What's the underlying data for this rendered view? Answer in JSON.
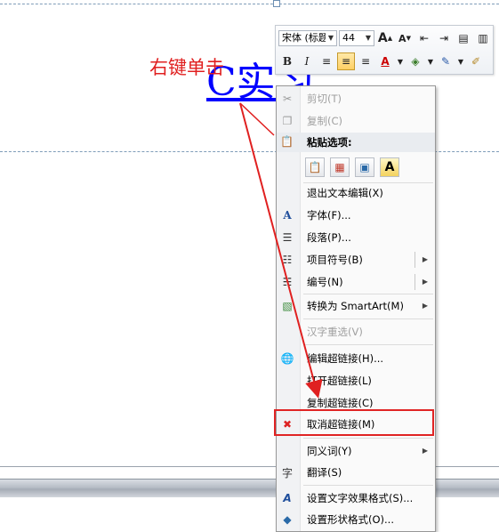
{
  "document": {
    "link_text": "C实习",
    "annotation": "右键单击"
  },
  "mini_toolbar": {
    "font_name": "宋体 (标题",
    "font_size": "44",
    "grow_icon": "A",
    "shrink_icon": "A",
    "bold": "B",
    "italic": "I",
    "font_color": "A"
  },
  "context_menu": {
    "items": [
      {
        "label": "剪切(T)",
        "icon": "scissors-icon",
        "disabled": true
      },
      {
        "label": "复制(C)",
        "icon": "copy-icon",
        "disabled": true
      },
      {
        "label": "粘贴选项:",
        "icon": "paste-icon",
        "header": true
      },
      {
        "label": "退出文本编辑(X)"
      },
      {
        "label": "字体(F)...",
        "icon": "font-icon"
      },
      {
        "label": "段落(P)...",
        "icon": "paragraph-icon"
      },
      {
        "label": "项目符号(B)",
        "icon": "bullets-icon",
        "submenu": true
      },
      {
        "label": "编号(N)",
        "icon": "numbering-icon",
        "submenu": true
      },
      {
        "label": "转换为 SmartArt(M)",
        "icon": "smartart-icon",
        "submenu": true
      },
      {
        "label": "汉字重选(V)",
        "disabled": true
      },
      {
        "label": "编辑超链接(H)...",
        "icon": "globe-link-icon"
      },
      {
        "label": "打开超链接(L)"
      },
      {
        "label": "复制超链接(C)"
      },
      {
        "label": "取消超链接(M)",
        "icon": "remove-link-icon"
      },
      {
        "label": "同义词(Y)",
        "submenu": true
      },
      {
        "label": "翻译(S)",
        "icon": "translate-icon"
      },
      {
        "label": "设置文字效果格式(S)...",
        "icon": "text-effects-icon"
      },
      {
        "label": "设置形状格式(O)...",
        "icon": "shape-format-icon"
      }
    ]
  },
  "colors": {
    "link": "#0000ff",
    "annotation": "#e02020",
    "highlight_box": "#e02424"
  }
}
